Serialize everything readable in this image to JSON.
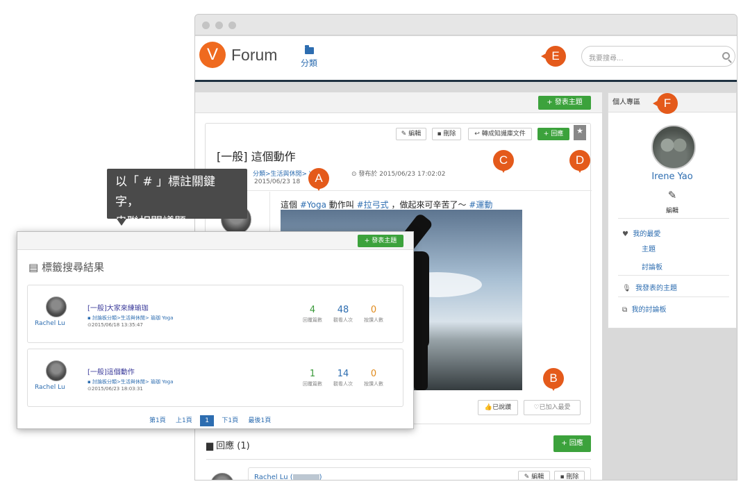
{
  "navbar": {
    "logo_letter": "V",
    "logo_text": "Forum",
    "category_label": "分類",
    "search_placeholder": "我要搜尋..."
  },
  "toolbar": {
    "new_topic": "+ 發表主題"
  },
  "post": {
    "actions": {
      "edit": "編輯",
      "delete": "刪除",
      "to_kb": "轉成知識庫文件",
      "reply": "+ 回應"
    },
    "title": "[一般] 這個動作",
    "breadcrumb": "分類>生活與休閒> Yoga",
    "published": "發布於 2015/06/23 17:02:02",
    "updated": "2015/06/23 18",
    "body_prefix": "這個 ",
    "tag1": "#Yoga",
    "body_mid1": " 動作叫 ",
    "tag2": "#拉弓式",
    "body_mid2": " ，做起來可辛苦了～ ",
    "tag3": "#運動",
    "liked": "已說讚",
    "favorited": "已加入最愛"
  },
  "replies": {
    "header": "回應 (1)",
    "reply_button": "+ 回應",
    "first_author": "Rachel Lu (",
    "edit": "編輯",
    "delete": "刪除"
  },
  "sidebar": {
    "header": "個人專區",
    "user_name": "Irene Yao",
    "edit": "編輯",
    "favorites": "我的最愛",
    "topics": "主題",
    "boards": "討論板",
    "my_topics": "我發表的主題",
    "my_boards": "我的討論板"
  },
  "markers": {
    "a": "A",
    "b": "B",
    "c": "C",
    "d": "D",
    "e": "E",
    "f": "F"
  },
  "tooltip": {
    "line1": "以「 # 」標註關鍵字，",
    "line2": "串聯相關議題"
  },
  "popup": {
    "new_topic": "+ 發表主題",
    "title": "標籤搜尋結果",
    "results": [
      {
        "author": "Rachel Lu",
        "title": "[一般]大家來練瑜珈",
        "path": "討論板分類>生活與休閒> 瑜珈 Yoga",
        "time": "2015/06/18 13:35:47",
        "replies": "4",
        "views": "48",
        "likes": "0"
      },
      {
        "author": "Rachel Lu",
        "title": "[一般]這個動作",
        "path": "討論板分類>生活與休閒> 瑜珈 Yoga",
        "time": "2015/06/23 18:03:31",
        "replies": "1",
        "views": "14",
        "likes": "0"
      }
    ],
    "stat_labels": {
      "replies": "回覆篇數",
      "views": "觀看人次",
      "likes": "按讚人數"
    },
    "pagination": {
      "first": "第1頁",
      "prev": "上1頁",
      "current": "1",
      "next": "下1頁",
      "last": "最後1頁"
    }
  },
  "colors": {
    "accent": "#e45a1b",
    "green": "#3ca23c",
    "link": "#2d6db0",
    "navy": "#1e3140"
  }
}
